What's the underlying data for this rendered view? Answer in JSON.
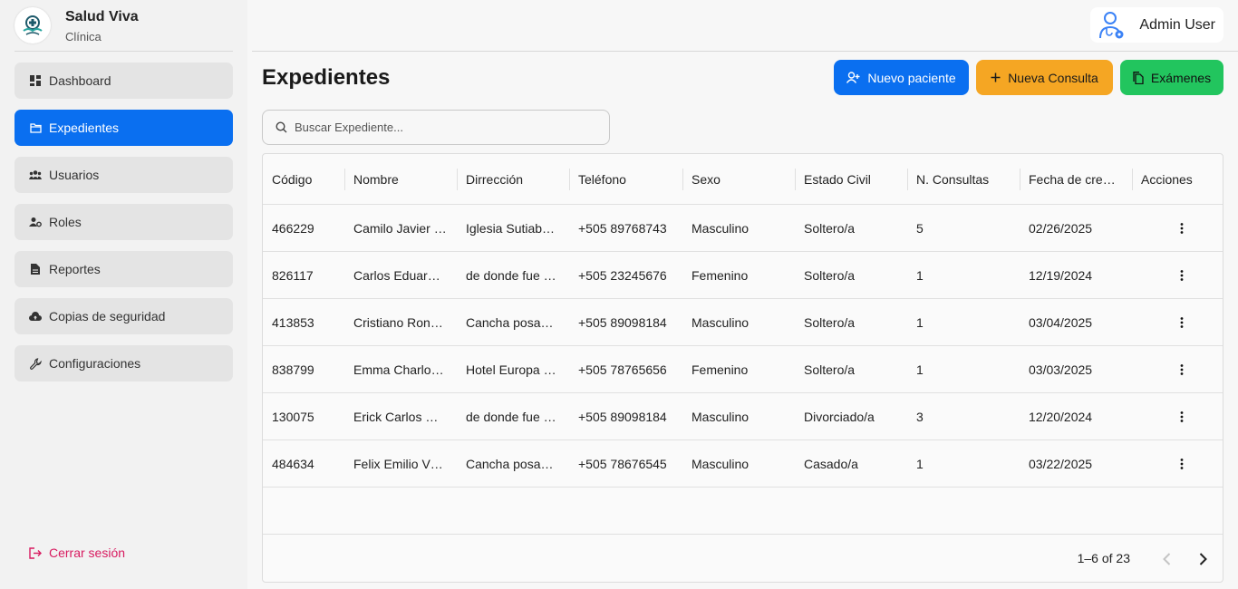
{
  "app": {
    "name": "Salud Viva",
    "subtitle": "Clínica"
  },
  "sidebar": {
    "items": [
      {
        "label": "Dashboard",
        "icon": "dashboard-icon",
        "active": false
      },
      {
        "label": "Expedientes",
        "icon": "folder-icon",
        "active": true
      },
      {
        "label": "Usuarios",
        "icon": "users-icon",
        "active": false
      },
      {
        "label": "Roles",
        "icon": "user-cog-icon",
        "active": false
      },
      {
        "label": "Reportes",
        "icon": "document-icon",
        "active": false
      },
      {
        "label": "Copias de seguridad",
        "icon": "cloud-upload-icon",
        "active": false
      },
      {
        "label": "Configuraciones",
        "icon": "wrench-icon",
        "active": false
      }
    ],
    "logout_label": "Cerrar sesión"
  },
  "header": {
    "user_name": "Admin User"
  },
  "main": {
    "title": "Expedientes",
    "buttons": {
      "new_patient": "Nuevo paciente",
      "new_consult": "Nueva Consulta",
      "exams": "Exámenes"
    },
    "search_placeholder": "Buscar Expediente...",
    "columns": [
      "Código",
      "Nombre",
      "Dirrección",
      "Teléfono",
      "Sexo",
      "Estado Civil",
      "N. Consultas",
      "Fecha de cre…",
      "Acciones"
    ],
    "rows": [
      [
        "466229",
        "Camilo Javier …",
        "Iglesia Sutiab…",
        "+505 89768743",
        "Masculino",
        "Soltero/a",
        "5",
        "02/26/2025"
      ],
      [
        "826117",
        "Carlos Eduar…",
        "de donde fue …",
        "+505 23245676",
        "Femenino",
        "Soltero/a",
        "1",
        "12/19/2024"
      ],
      [
        "413853",
        "Cristiano Ron…",
        "Cancha posa…",
        "+505 89098184",
        "Masculino",
        "Soltero/a",
        "1",
        "03/04/2025"
      ],
      [
        "838799",
        "Emma Charlo…",
        "Hotel Europa …",
        "+505 78765656",
        "Femenino",
        "Soltero/a",
        "1",
        "03/03/2025"
      ],
      [
        "130075",
        "Erick Carlos …",
        "de donde fue …",
        "+505 89098184",
        "Masculino",
        "Divorciado/a",
        "3",
        "12/20/2024"
      ],
      [
        "484634",
        "Felix Emilio V…",
        "Cancha posa…",
        "+505 78676545",
        "Masculino",
        "Casado/a",
        "1",
        "03/22/2025"
      ]
    ],
    "pagination": "1–6 of 23"
  },
  "colors": {
    "primary": "#0a6ff0",
    "warning": "#f5a623",
    "success": "#22c55e",
    "logout": "#d81b60"
  }
}
